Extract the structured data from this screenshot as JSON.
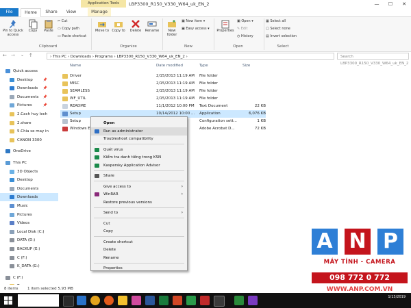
{
  "window": {
    "app_tools_label": "Application Tools",
    "title": "LBP3300_R150_V330_W64_uk_EN_2",
    "minimize": "—",
    "maximize": "☐",
    "close": "✕"
  },
  "tabs": [
    "File",
    "Home",
    "Share",
    "View",
    "Manage"
  ],
  "ribbon": {
    "pin_quick_access": "Pin to Quick access",
    "copy": "Copy",
    "paste": "Paste",
    "cut": "Cut",
    "copy_path": "Copy path",
    "paste_shortcut": "Paste shortcut",
    "move_to": "Move to",
    "copy_to": "Copy to",
    "delete": "Delete",
    "rename": "Rename",
    "new_folder": "New folder",
    "new_item": "New item",
    "easy_access": "Easy access",
    "properties": "Properties",
    "open": "Open",
    "edit": "Edit",
    "history": "History",
    "select_all": "Select all",
    "select_none": "Select none",
    "invert_selection": "Invert selection",
    "groups": {
      "clipboard": "Clipboard",
      "organize": "Organize",
      "new": "New",
      "open": "Open",
      "select": "Select"
    }
  },
  "address": {
    "path": "› This PC › Downloads › Programs › LBP3300_R150_V330_W64_uk_EN_2 ›",
    "search_placeholder": "Search LBP3300_R150_V330_W64_uk_EN_2"
  },
  "nav": {
    "items": [
      {
        "label": "Quick access",
        "color": "#4a90d9"
      },
      {
        "label": "Desktop",
        "color": "#3b8fd6"
      },
      {
        "label": "Downloads",
        "color": "#2e7dd1"
      },
      {
        "label": "Documents",
        "color": "#9aa8b8"
      },
      {
        "label": "Pictures",
        "color": "#6fa7d8"
      },
      {
        "label": "2.Cach huy lech",
        "color": "#e8c35a"
      },
      {
        "label": "2.share",
        "color": "#e8c35a"
      },
      {
        "label": "5.Chia se may in",
        "color": "#e8c35a"
      },
      {
        "label": "CANON 3300",
        "color": "#e8c35a"
      },
      {
        "label": "OneDrive",
        "color": "#2f78c4"
      },
      {
        "label": "This PC",
        "color": "#5a9bd6"
      },
      {
        "label": "3D Objects",
        "color": "#6bb2e6"
      },
      {
        "label": "Desktop",
        "color": "#3b8fd6"
      },
      {
        "label": "Documents",
        "color": "#9aa8b8"
      },
      {
        "label": "Downloads",
        "color": "#2e7dd1"
      },
      {
        "label": "Music",
        "color": "#5c8fd1"
      },
      {
        "label": "Pictures",
        "color": "#6fa7d8"
      },
      {
        "label": "Videos",
        "color": "#5b7fc7"
      },
      {
        "label": "Local Disk (C:)",
        "color": "#8aa0b8"
      },
      {
        "label": "DATA (D:)",
        "color": "#8a9099"
      },
      {
        "label": "BACKUP (E:)",
        "color": "#8a9099"
      },
      {
        "label": "C (F:)",
        "color": "#8a9099"
      },
      {
        "label": "K_DATA (G:)",
        "color": "#8a9099"
      },
      {
        "label": "C (F:)",
        "color": "#8a9099"
      },
      {
        "label": "Tam",
        "color": "#e8c35a"
      }
    ]
  },
  "files": {
    "headers": {
      "name": "Name",
      "date": "Date modified",
      "type": "Type",
      "size": "Size"
    },
    "rows": [
      {
        "name": "Driver",
        "date": "2/15/2013 11:19 AM",
        "type": "File folder",
        "size": "",
        "color": "#e8c35a"
      },
      {
        "name": "MISC",
        "date": "2/15/2013 11:19 AM",
        "type": "File folder",
        "size": "",
        "color": "#e8c35a"
      },
      {
        "name": "SEAMLESS",
        "date": "2/15/2013 11:19 AM",
        "type": "File folder",
        "size": "",
        "color": "#e8c35a"
      },
      {
        "name": "WF_UTIL",
        "date": "2/15/2013 11:19 AM",
        "type": "File folder",
        "size": "",
        "color": "#e8c35a"
      },
      {
        "name": "README",
        "date": "11/1/2012 10:00 PM",
        "type": "Text Document",
        "size": "22 KB",
        "color": "#c9d3df"
      },
      {
        "name": "Setup",
        "date": "10/14/2012 10:00 ...",
        "type": "Application",
        "size": "6,076 KB",
        "color": "#5e8fcf"
      },
      {
        "name": "Setup",
        "date": "",
        "type": "Configuration sett...",
        "size": "1 KB",
        "color": "#b8c3cf"
      },
      {
        "name": "Windows E",
        "date": "",
        "type": "Adobe Acrobat D...",
        "size": "72 KB",
        "color": "#c93b3b"
      }
    ]
  },
  "context_menu": {
    "items": [
      {
        "label": "Open",
        "bold": true
      },
      {
        "label": "Run as administrator",
        "icon": "shield"
      },
      {
        "label": "Troubleshoot compatibility"
      },
      {
        "sep": true
      },
      {
        "label": "Quét virus",
        "icon": "kaspersky"
      },
      {
        "label": "Kiểm tra danh tiếng trong KSN",
        "icon": "kaspersky"
      },
      {
        "label": "Kaspersky Application Advisor",
        "icon": "kaspersky"
      },
      {
        "sep": true
      },
      {
        "label": "Share",
        "icon": "share"
      },
      {
        "sep": true
      },
      {
        "label": "Give access to",
        "arrow": true
      },
      {
        "label": "WinRAR",
        "icon": "winrar",
        "arrow": true
      },
      {
        "label": "Restore previous versions"
      },
      {
        "sep": true
      },
      {
        "label": "Send to",
        "arrow": true
      },
      {
        "sep": true
      },
      {
        "label": "Cut"
      },
      {
        "label": "Copy"
      },
      {
        "sep": true
      },
      {
        "label": "Create shortcut"
      },
      {
        "label": "Delete"
      },
      {
        "label": "Rename"
      },
      {
        "sep": true
      },
      {
        "label": "Properties"
      }
    ]
  },
  "status": {
    "items": "8 items",
    "selected": "1 item selected  5.93 MB"
  },
  "taskbar": {
    "search_placeholder": "",
    "time": "",
    "date": "1/13/2019"
  },
  "watermark": {
    "letters": [
      "A",
      "N",
      "P"
    ],
    "subtitle": "MÁY TÍNH - CAMERA",
    "phone": "098 772 0 772",
    "website": "WWW.ANP.COM.VN"
  },
  "colors": {
    "accent": "#1979ca",
    "selection": "#cce8ff",
    "anp_blue": "#2e7fd6",
    "anp_red": "#c4141c"
  }
}
